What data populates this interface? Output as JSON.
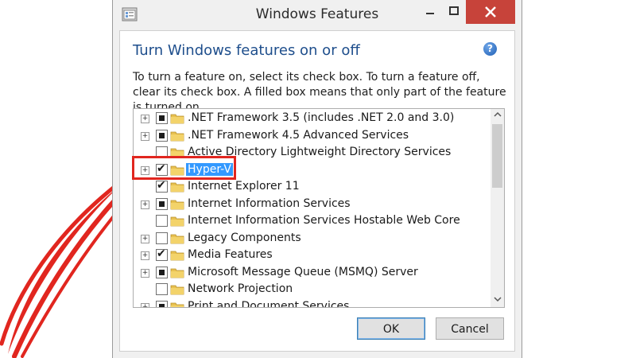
{
  "window": {
    "title": "Windows Features"
  },
  "dialog": {
    "heading": "Turn Windows features on or off",
    "help_icon": "?",
    "description": "To turn a feature on, select its check box. To turn a feature off, clear its check box. A filled box means that only part of the feature is turned on."
  },
  "features": [
    {
      "label": ".NET Framework 3.5 (includes .NET 2.0 and 3.0)",
      "state": "partial",
      "expandable": true
    },
    {
      "label": ".NET Framework 4.5 Advanced Services",
      "state": "partial",
      "expandable": true
    },
    {
      "label": "Active Directory Lightweight Directory Services",
      "state": "unchecked",
      "expandable": false
    },
    {
      "label": "Hyper-V",
      "state": "checked",
      "expandable": true,
      "selected": true
    },
    {
      "label": "Internet Explorer 11",
      "state": "checked",
      "expandable": false
    },
    {
      "label": "Internet Information Services",
      "state": "partial",
      "expandable": true
    },
    {
      "label": "Internet Information Services Hostable Web Core",
      "state": "unchecked",
      "expandable": false
    },
    {
      "label": "Legacy Components",
      "state": "unchecked",
      "expandable": true
    },
    {
      "label": "Media Features",
      "state": "checked",
      "expandable": true
    },
    {
      "label": "Microsoft Message Queue (MSMQ) Server",
      "state": "partial",
      "expandable": true
    },
    {
      "label": "Network Projection",
      "state": "unchecked",
      "expandable": false
    },
    {
      "label": "Print and Document Services",
      "state": "partial",
      "expandable": true
    }
  ],
  "buttons": {
    "ok": "OK",
    "cancel": "Cancel"
  },
  "colors": {
    "accent_heading": "#1e4e8c",
    "close_button": "#c7433a",
    "selection": "#3399ff",
    "annotation_red": "#e1261f"
  },
  "icons": {
    "app": "windows-features-app-icon",
    "folder": "folder-icon",
    "help": "help-icon",
    "minimize": "minimize-icon",
    "maximize": "maximize-icon",
    "close": "close-icon"
  }
}
